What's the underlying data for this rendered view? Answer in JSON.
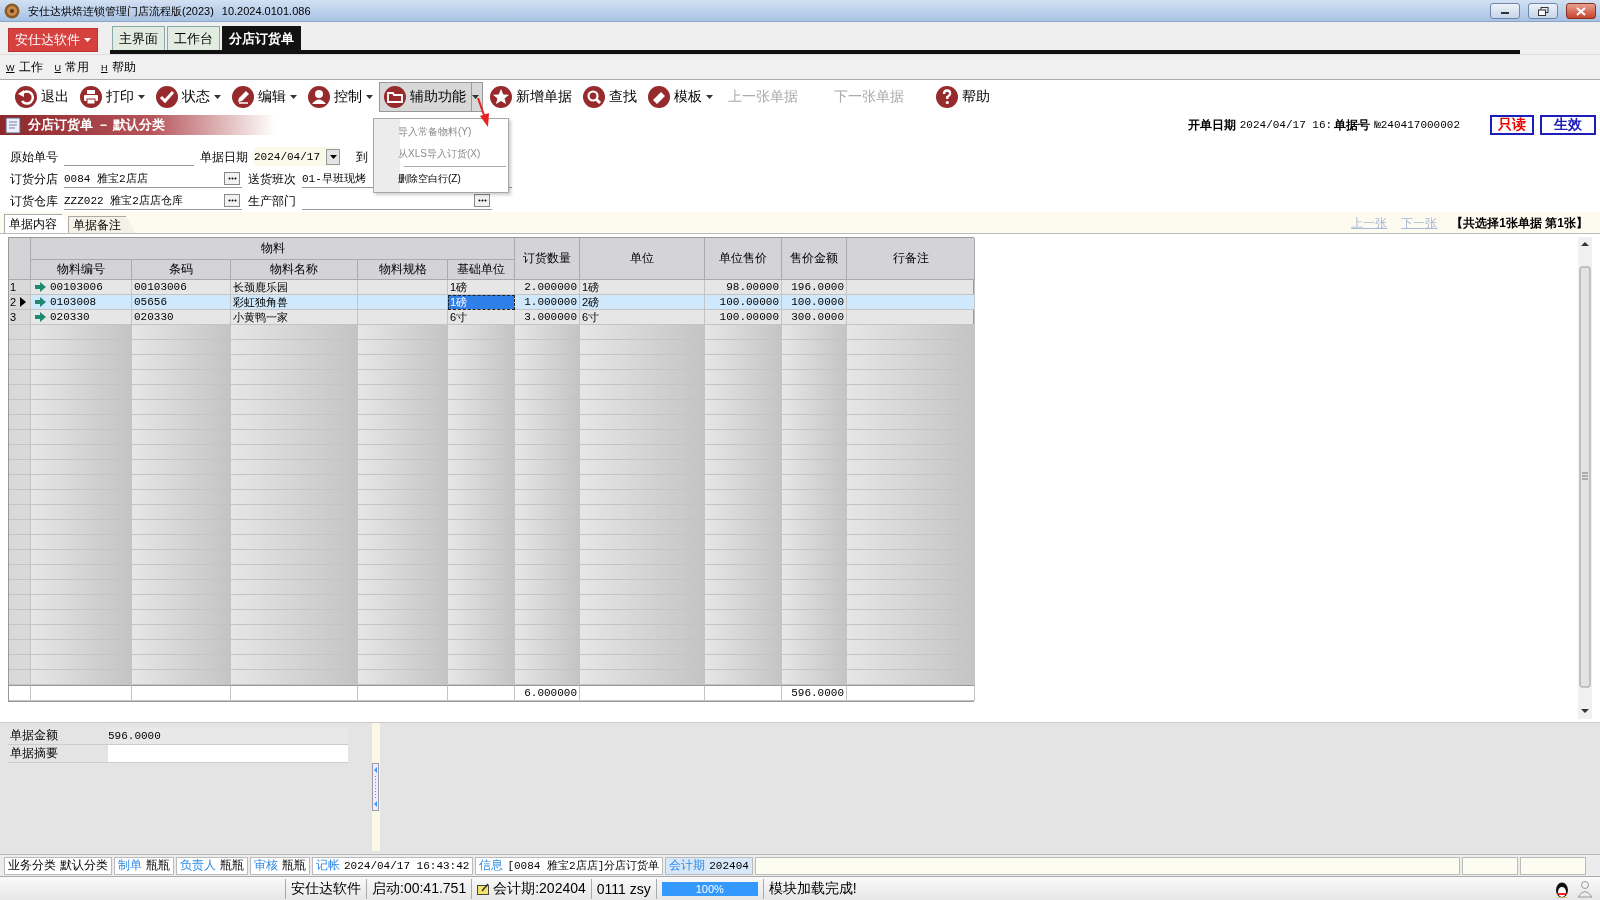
{
  "window": {
    "title": "安仕达烘焙连锁管理门店流程版(2023)",
    "version": "10.2024.0101.086"
  },
  "app_button": {
    "label": "安仕达软件"
  },
  "app_tabs": [
    {
      "label": "主界面",
      "selected": false
    },
    {
      "label": "工作台",
      "selected": false
    },
    {
      "label": "分店订货单",
      "selected": true
    }
  ],
  "menu": [
    {
      "hotkey": "W",
      "label": "工作"
    },
    {
      "hotkey": "U",
      "label": "常用"
    },
    {
      "hotkey": "H",
      "label": "帮助"
    }
  ],
  "toolbar": [
    {
      "label": "退出",
      "has_menu": false,
      "disabled": false,
      "expanded": false
    },
    {
      "label": "打印",
      "has_menu": true,
      "disabled": false,
      "expanded": false
    },
    {
      "label": "状态",
      "has_menu": true,
      "disabled": false,
      "expanded": false
    },
    {
      "label": "编辑",
      "has_menu": true,
      "disabled": false,
      "expanded": false
    },
    {
      "label": "控制",
      "has_menu": true,
      "disabled": false,
      "expanded": false
    },
    {
      "label": "辅助功能",
      "has_menu": true,
      "disabled": false,
      "expanded": true
    },
    {
      "label": "新增单据",
      "has_menu": false,
      "disabled": false,
      "expanded": false
    },
    {
      "label": "查找",
      "has_menu": false,
      "disabled": false,
      "expanded": false
    },
    {
      "label": "模板",
      "has_menu": true,
      "disabled": false,
      "expanded": false
    },
    {
      "label": "上一张单据",
      "has_menu": false,
      "disabled": true,
      "expanded": false
    },
    {
      "label": "下一张单据",
      "has_menu": false,
      "disabled": true,
      "expanded": false
    },
    {
      "label": "帮助",
      "has_menu": false,
      "disabled": false,
      "expanded": false
    }
  ],
  "dropdown_menu": [
    {
      "label": "导入常备物料(Y)",
      "disabled": true,
      "separator_before": false
    },
    {
      "label": "从XLS导入订货(X)",
      "disabled": true,
      "separator_before": false
    },
    {
      "label": "删除空白行(Z)",
      "disabled": false,
      "separator_before": true
    }
  ],
  "document": {
    "title": "分店订货单 － 默认分类",
    "open_date_label": "开单日期",
    "open_date": "2024/04/17 16:",
    "number_label": "单据号",
    "number": "№240417000002",
    "badges": [
      {
        "label": "只读",
        "kind": "readonly"
      },
      {
        "label": "生效",
        "kind": "status"
      }
    ]
  },
  "form": [
    [
      {
        "label": "原始单号",
        "kind": "text"
      },
      {
        "label": "单据日期",
        "kind": "date",
        "value": "2024/04/17"
      },
      {
        "label": "到",
        "kind": "label"
      }
    ],
    [
      {
        "label": "订货分店",
        "kind": "lookup",
        "value": "0084 雅宝2店店"
      },
      {
        "label": "送货班次",
        "kind": "text",
        "value": "01-早班现烤"
      }
    ],
    [
      {
        "label": "订货仓库",
        "kind": "lookup",
        "value": "ZZZ022 雅宝2店店仓库"
      },
      {
        "label": "生产部门",
        "kind": "lookup"
      }
    ]
  ],
  "doc_tabs": [
    {
      "label": "单据内容",
      "selected": true
    },
    {
      "label": "单据备注",
      "selected": false
    }
  ],
  "record_nav": {
    "prev": "上一张",
    "next": "下一张",
    "disabled": true,
    "summary": "【共选择1张单据  第1张】"
  },
  "table": {
    "group": "物料",
    "columns": [
      "物料编号",
      "条码",
      "物料名称",
      "物料规格",
      "基础单位",
      "订货数量",
      "单位",
      "单位售价",
      "售价金额",
      "行备注"
    ],
    "rows": [
      {
        "no": "1",
        "selected": false,
        "editing": false,
        "code": "00103006",
        "barcode": "00103006",
        "name": "长颈鹿乐园",
        "base_unit": "1磅",
        "qty": "2.000000",
        "unit": "1磅",
        "price": "98.00000",
        "amount": "196.0000"
      },
      {
        "no": "2",
        "selected": true,
        "editing": true,
        "code": "0103008",
        "barcode": "05656",
        "name": "彩虹独角兽",
        "base_unit": "1磅",
        "qty": "1.000000",
        "unit": "2磅",
        "price": "100.00000",
        "amount": "100.0000"
      },
      {
        "no": "3",
        "selected": false,
        "editing": false,
        "code": "020330",
        "barcode": "020330",
        "name": "小黄鸭一家",
        "base_unit": "6寸",
        "qty": "3.000000",
        "unit": "6寸",
        "price": "100.00000",
        "amount": "300.0000"
      }
    ],
    "totals": {
      "qty": "6.000000",
      "amount": "596.0000"
    }
  },
  "summary": [
    {
      "label": "单据金额",
      "value": "596.0000"
    },
    {
      "label": "单据摘要"
    }
  ],
  "status_bar": [
    {
      "label": "业务分类",
      "value": "默认分类",
      "kind": "plain"
    },
    {
      "label": "制单",
      "value": "瓶瓶",
      "kind": "link"
    },
    {
      "label": "负责人",
      "value": "瓶瓶",
      "kind": "link"
    },
    {
      "label": "审核",
      "value": "瓶瓶",
      "kind": "link"
    },
    {
      "label": "记帐",
      "value": "2024/04/17 16:43:42",
      "kind": "link"
    },
    {
      "label": "信息",
      "value": "[0084 雅宝2店店]分店订货单",
      "kind": "link"
    },
    {
      "label": "会计期",
      "value": "202404",
      "kind": "active"
    }
  ],
  "footer": [
    {
      "kind": "text",
      "text": "安仕达软件"
    },
    {
      "kind": "text",
      "text": "启动:00:41.751"
    },
    {
      "kind": "icon_text",
      "text": "会计期:202404"
    },
    {
      "kind": "text",
      "text": "0111 zsy"
    },
    {
      "kind": "progress",
      "text": "100%",
      "level": 1
    },
    {
      "kind": "message",
      "text": "模块加载完成!"
    }
  ]
}
